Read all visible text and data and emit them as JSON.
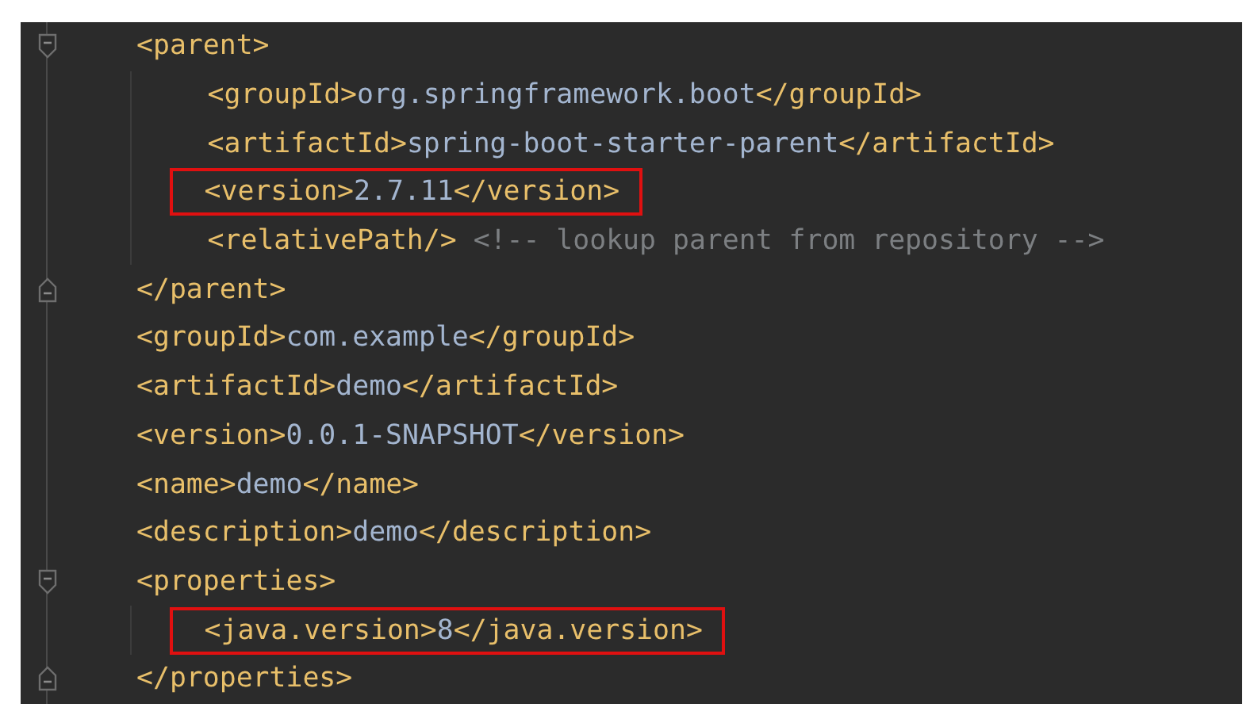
{
  "editor": {
    "lines": [
      {
        "kind": "opener",
        "highlighted": false,
        "segments": [
          {
            "kind": "tag",
            "text": "<parent>"
          }
        ],
        "children": [
          {
            "highlighted": false,
            "segments": [
              {
                "kind": "tag",
                "text": "<groupId>"
              },
              {
                "kind": "value",
                "text": "org.springframework.boot"
              },
              {
                "kind": "tag",
                "text": "</groupId>"
              }
            ]
          },
          {
            "highlighted": false,
            "segments": [
              {
                "kind": "tag",
                "text": "<artifactId>"
              },
              {
                "kind": "value",
                "text": "spring-boot-starter-parent"
              },
              {
                "kind": "tag",
                "text": "</artifactId>"
              }
            ]
          },
          {
            "highlighted": true,
            "segments": [
              {
                "kind": "tag",
                "text": "<version>"
              },
              {
                "kind": "value",
                "text": "2.7.11"
              },
              {
                "kind": "tag",
                "text": "</version>"
              }
            ]
          },
          {
            "highlighted": false,
            "segments": [
              {
                "kind": "tag",
                "text": "<relativePath/>"
              },
              {
                "kind": "comment",
                "text": " <!-- lookup parent from repository -->"
              }
            ]
          }
        ]
      },
      {
        "kind": "closer",
        "highlighted": false,
        "segments": [
          {
            "kind": "tag",
            "text": "</parent>"
          }
        ]
      },
      {
        "highlighted": false,
        "segments": [
          {
            "kind": "tag",
            "text": "<groupId>"
          },
          {
            "kind": "value",
            "text": "com.example"
          },
          {
            "kind": "tag",
            "text": "</groupId>"
          }
        ]
      },
      {
        "highlighted": false,
        "segments": [
          {
            "kind": "tag",
            "text": "<artifactId>"
          },
          {
            "kind": "value",
            "text": "demo"
          },
          {
            "kind": "tag",
            "text": "</artifactId>"
          }
        ]
      },
      {
        "highlighted": false,
        "segments": [
          {
            "kind": "tag",
            "text": "<version>"
          },
          {
            "kind": "value",
            "text": "0.0.1-SNAPSHOT"
          },
          {
            "kind": "tag",
            "text": "</version>"
          }
        ]
      },
      {
        "highlighted": false,
        "segments": [
          {
            "kind": "tag",
            "text": "<name>"
          },
          {
            "kind": "value",
            "text": "demo"
          },
          {
            "kind": "tag",
            "text": "</name>"
          }
        ]
      },
      {
        "highlighted": false,
        "segments": [
          {
            "kind": "tag",
            "text": "<description>"
          },
          {
            "kind": "value",
            "text": "demo"
          },
          {
            "kind": "tag",
            "text": "</description>"
          }
        ]
      },
      {
        "kind": "opener",
        "highlighted": false,
        "segments": [
          {
            "kind": "tag",
            "text": "<properties>"
          }
        ],
        "children": [
          {
            "highlighted": true,
            "segments": [
              {
                "kind": "tag",
                "text": "<java.version>"
              },
              {
                "kind": "value",
                "text": "8"
              },
              {
                "kind": "tag",
                "text": "</java.version>"
              }
            ]
          }
        ]
      },
      {
        "kind": "closer",
        "highlighted": false,
        "segments": [
          {
            "kind": "tag",
            "text": "</properties>"
          }
        ]
      }
    ]
  }
}
